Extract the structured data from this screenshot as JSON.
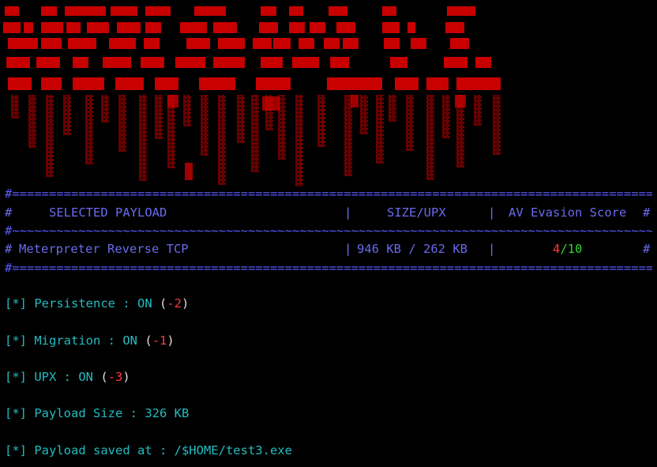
{
  "banner": {
    "color": "#c80000",
    "dim_color": "#7a0000"
  },
  "table": {
    "headers": [
      "SELECTED PAYLOAD",
      "SIZE/UPX",
      "AV Evasion Score"
    ],
    "row": {
      "payload": "Meterpreter Reverse TCP",
      "size": "946 KB / 262 KB",
      "score": "4",
      "score_total": "/10"
    }
  },
  "log": [
    {
      "label": "Persistence : ON",
      "delta": "-2"
    },
    {
      "label": "Migration : ON",
      "delta": "-1"
    },
    {
      "label": "UPX : ON",
      "delta": "-3"
    }
  ],
  "payload_size": "Payload Size : 326 KB",
  "saved_at": "Payload saved at : /$HOME/test3.exe",
  "prefix": "[*]"
}
